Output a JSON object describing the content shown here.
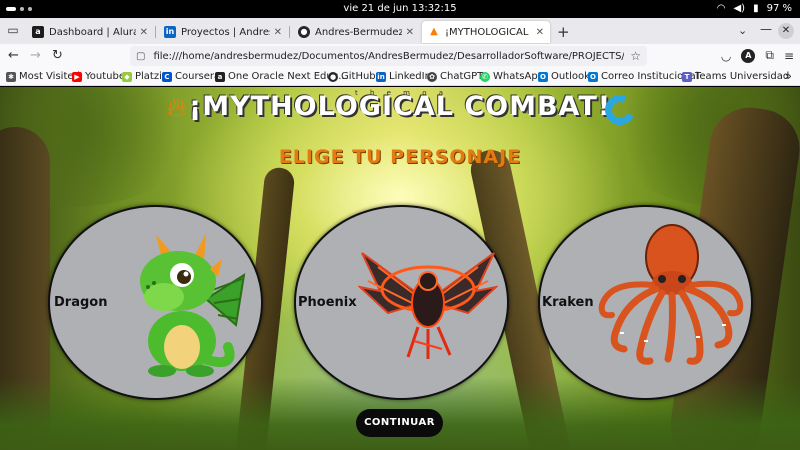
{
  "system": {
    "clock": "vie 21 de jun  13:32:15",
    "battery": "97 %"
  },
  "browser": {
    "tabs": [
      {
        "title": "Dashboard | Alura Latam",
        "favicon": "a",
        "color": "#1c1c1c"
      },
      {
        "title": "Proyectos | Andres Berm",
        "favicon": "in",
        "color": "#0a66c2"
      },
      {
        "title": "Andres-Bermudez/Juego",
        "favicon": "gh",
        "color": "#24292f"
      },
      {
        "title": "¡MYTHOLOGICAL COMBA",
        "favicon": "fire",
        "color": "#ff7a00"
      }
    ],
    "url": "file:///home/andresbermudez/Documentos/AndresBermudez/DesarrolladorSoftware/PROJECTS/HTML - CSS - JAVASCR",
    "bookmarks": [
      {
        "label": "Most Visited",
        "color": "#555"
      },
      {
        "label": "Youtube",
        "color": "#ff0000"
      },
      {
        "label": "Platzi",
        "color": "#98ca3f"
      },
      {
        "label": "Coursera",
        "color": "#0056d2"
      },
      {
        "label": "One Oracle Next Educ...",
        "color": "#222"
      },
      {
        "label": "GitHub",
        "color": "#24292f"
      },
      {
        "label": "LinkedIn",
        "color": "#0a66c2"
      },
      {
        "label": "ChatGPT",
        "color": "#444"
      },
      {
        "label": "WhatsApp",
        "color": "#25d366"
      },
      {
        "label": "Outlook",
        "color": "#0078d4"
      },
      {
        "label": "Correo Institucional",
        "color": "#0078d4"
      },
      {
        "label": "Teams Universidad",
        "color": "#5b5fc7"
      }
    ]
  },
  "game": {
    "title": "¡MYTHOLOGICAL COMBAT!",
    "tiny_text": "t h e m o a",
    "subtitle": "ELIGE TU PERSONAJE",
    "characters": [
      {
        "name": "Dragon"
      },
      {
        "name": "Phoenix"
      },
      {
        "name": "Kraken"
      }
    ],
    "continue_label": "CONTINUAR"
  },
  "colors": {
    "subtitle": "#e37b12",
    "card_bg": "#aeb0b3",
    "button_bg": "#0b0b0b"
  }
}
